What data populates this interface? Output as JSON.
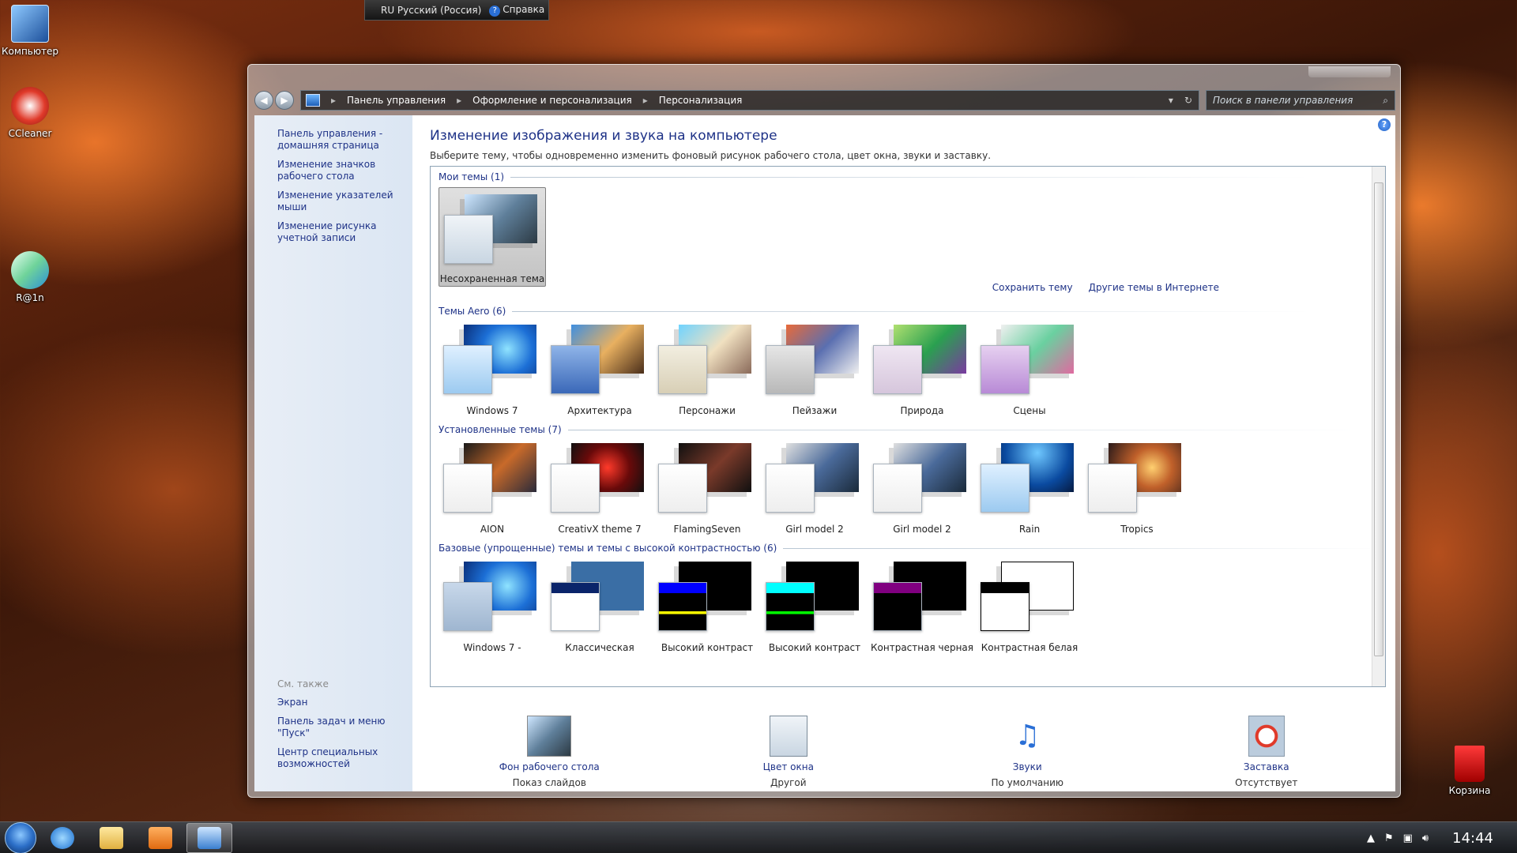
{
  "desktop": {
    "icons": [
      {
        "label": "Компьютер"
      },
      {
        "label": "CCleaner"
      },
      {
        "label": "R@1n"
      },
      {
        "label": "Корзина"
      }
    ]
  },
  "langbar": {
    "lang": "RU Русский (Россия)",
    "help": "Справка"
  },
  "nav": {
    "breadcrumb": [
      "Панель управления",
      "Оформление и персонализация",
      "Персонализация"
    ],
    "search_placeholder": "Поиск в панели управления"
  },
  "sidebar": {
    "links": [
      "Панель управления - домашняя страница",
      "Изменение значков рабочего стола",
      "Изменение указателей мыши",
      "Изменение рисунка учетной записи"
    ],
    "see_also_title": "См. также",
    "see_also": [
      "Экран",
      "Панель задач и меню \"Пуск\"",
      "Центр специальных возможностей"
    ]
  },
  "main": {
    "title": "Изменение изображения и звука на компьютере",
    "description": "Выберите тему, чтобы одновременно изменить фоновый рисунок рабочего стола, цвет окна, звуки и заставку.",
    "save_theme": "Сохранить тему",
    "more_themes": "Другие темы в Интернете",
    "groups": {
      "my": {
        "title": "Мои темы (1)",
        "items": [
          "Несохраненная тема"
        ]
      },
      "aero": {
        "title": "Темы Aero (6)",
        "items": [
          "Windows 7",
          "Архитектура",
          "Персонажи",
          "Пейзажи",
          "Природа",
          "Сцены"
        ]
      },
      "installed": {
        "title": "Установленные темы (7)",
        "items": [
          "AION",
          "CreativX theme 7",
          "FlamingSeven",
          "Girl model 2",
          "Girl model 2",
          "Rain",
          "Tropics"
        ]
      },
      "basic": {
        "title": "Базовые (упрощенные) темы и темы с высокой контрастностью (6)",
        "items": [
          "Windows 7 -",
          "Классическая",
          "Высокий контраст",
          "Высокий контраст",
          "Контрастная черная",
          "Контрастная белая"
        ]
      }
    }
  },
  "bottom": [
    {
      "name": "Фон рабочего стола",
      "value": "Показ слайдов"
    },
    {
      "name": "Цвет окна",
      "value": "Другой"
    },
    {
      "name": "Звуки",
      "value": "По умолчанию"
    },
    {
      "name": "Заставка",
      "value": "Отсутствует"
    }
  ],
  "taskbar": {
    "clock": "14:44"
  }
}
